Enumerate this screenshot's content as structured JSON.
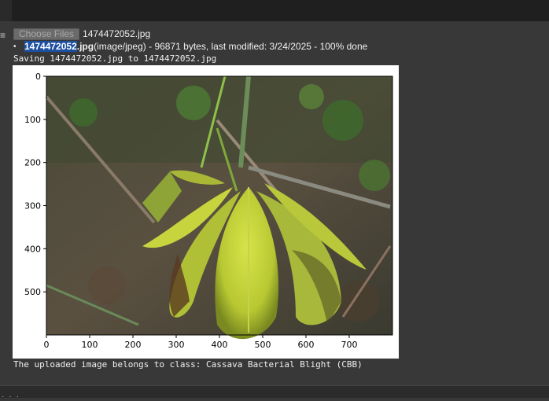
{
  "upload": {
    "button_label": "Choose Files",
    "selected_file": "1474472052.jpg",
    "file_entry": {
      "name_highlighted": "1474472052",
      "extension": ".jpg",
      "details": "(image/jpeg) - 96871 bytes, last modified: 3/24/2025 - 100% done"
    },
    "saving_message": "Saving 1474472052.jpg to 1474472052.jpg"
  },
  "figure": {
    "x_ticks": [
      "0",
      "100",
      "200",
      "300",
      "400",
      "500",
      "600",
      "700"
    ],
    "y_ticks": [
      "0",
      "100",
      "200",
      "300",
      "400",
      "500"
    ],
    "image_description_icon": "cassava-leaf-photo"
  },
  "result_text": "The uploaded image belongs to class: Cassava Bacterial Blight (CBB)",
  "colors": {
    "background": "#383838",
    "highlight": "#1c4fa0"
  }
}
